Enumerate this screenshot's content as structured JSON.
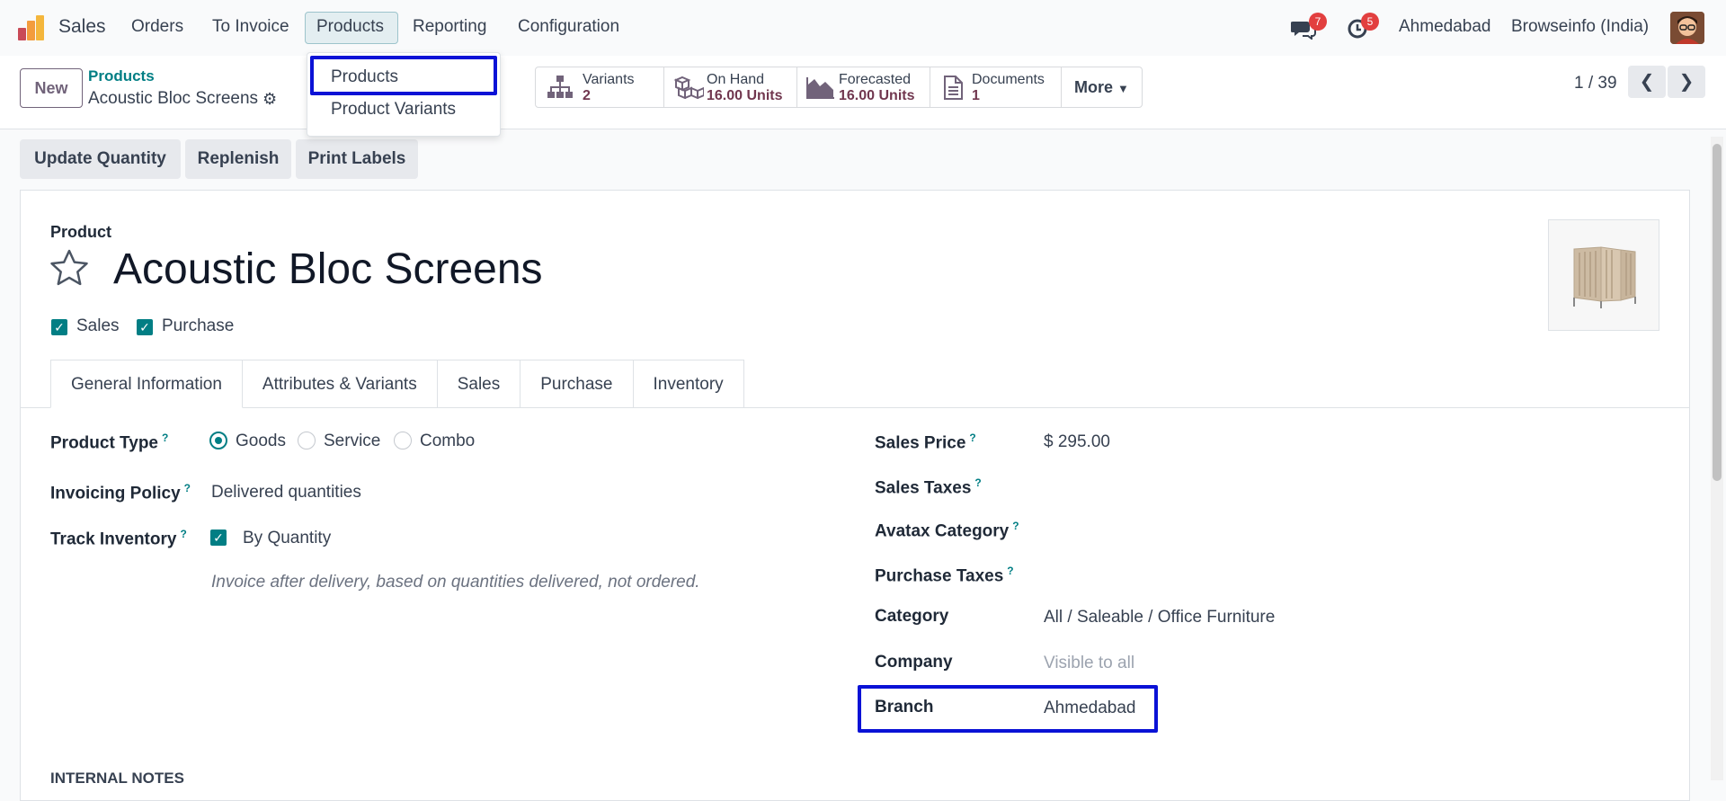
{
  "nav": {
    "app": "Sales",
    "menu": [
      "Orders",
      "To Invoice",
      "Products",
      "Reporting",
      "Configuration"
    ],
    "messages_count": "7",
    "activities_count": "5",
    "branch": "Ahmedabad",
    "company": "Browseinfo (India)"
  },
  "dropdown": {
    "items": [
      "Products",
      "Product Variants"
    ]
  },
  "control": {
    "new_label": "New",
    "breadcrumb_parent": "Products",
    "breadcrumb_current": "Acoustic Bloc Screens",
    "pager": "1 / 39",
    "smart_buttons": [
      {
        "title": "Variants",
        "value": "2",
        "icon": "sitemap-icon"
      },
      {
        "title": "On Hand",
        "value": "16.00 Units",
        "icon": "cubes-icon"
      },
      {
        "title": "Forecasted",
        "value": "16.00 Units",
        "icon": "area-chart-icon"
      },
      {
        "title": "Documents",
        "value": "1",
        "icon": "file-icon"
      }
    ],
    "more_label": "More"
  },
  "status_buttons": [
    "Update Quantity",
    "Replenish",
    "Print Labels"
  ],
  "form": {
    "product_label": "Product",
    "name": "Acoustic Bloc Screens",
    "sales_check": "Sales",
    "purchase_check": "Purchase",
    "tabs": [
      "General Information",
      "Attributes & Variants",
      "Sales",
      "Purchase",
      "Inventory"
    ],
    "left": {
      "product_type_label": "Product Type",
      "product_type_options": [
        "Goods",
        "Service",
        "Combo"
      ],
      "product_type_selected": "Goods",
      "invoicing_policy_label": "Invoicing Policy",
      "invoicing_policy_value": "Delivered quantities",
      "track_inventory_label": "Track Inventory",
      "track_inventory_value": "By Quantity",
      "hint": "Invoice after delivery, based on quantities delivered, not ordered."
    },
    "right": {
      "sales_price_label": "Sales Price",
      "sales_price_value": "$ 295.00",
      "sales_taxes_label": "Sales Taxes",
      "avatax_label": "Avatax Category",
      "purchase_taxes_label": "Purchase Taxes",
      "category_label": "Category",
      "category_value": "All / Saleable / Office Furniture",
      "company_label": "Company",
      "company_value": "Visible to all",
      "branch_label": "Branch",
      "branch_value": "Ahmedabad"
    },
    "internal_notes_label": "INTERNAL NOTES"
  },
  "colors": {
    "accent": "#017e84",
    "highlight_box": "#0a12d6",
    "smart_value": "#71374f"
  }
}
